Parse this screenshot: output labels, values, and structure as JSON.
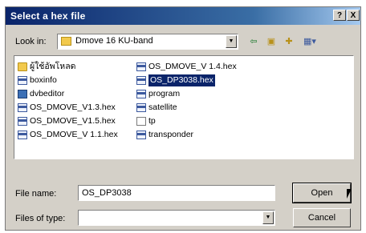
{
  "window": {
    "title": "Select a hex file",
    "help_label": "?",
    "close_label": "X"
  },
  "lookin": {
    "label": "Look in:",
    "value": "Dmove 16 KU-band"
  },
  "toolbar": {
    "back_icon": "back-arrow-icon",
    "up_icon": "up-folder-icon",
    "newfolder_icon": "new-folder-icon",
    "views_icon": "views-menu-icon"
  },
  "files": {
    "left": [
      {
        "name": "ผู้ใช้อัพโหลด",
        "icon": "folder-icon"
      },
      {
        "name": "boxinfo",
        "icon": "file-icon"
      },
      {
        "name": "dvbeditor",
        "icon": "app-icon"
      },
      {
        "name": "OS_DMOVE_V1.3.hex",
        "icon": "file-icon"
      },
      {
        "name": "OS_DMOVE_V1.5.hex",
        "icon": "file-icon"
      },
      {
        "name": "OS_DMOVE_V 1.1.hex",
        "icon": "file-icon"
      }
    ],
    "right": [
      {
        "name": "OS_DMOVE_V 1.4.hex",
        "icon": "file-icon"
      },
      {
        "name": "OS_DP3038.hex",
        "icon": "file-icon",
        "selected": true
      },
      {
        "name": "program",
        "icon": "file-icon"
      },
      {
        "name": "satellite",
        "icon": "file-icon"
      },
      {
        "name": "tp",
        "icon": "blank-file-icon"
      },
      {
        "name": "transponder",
        "icon": "file-icon"
      }
    ]
  },
  "filename": {
    "label": "File name:",
    "value": "OS_DP3038"
  },
  "filetype": {
    "label": "Files of type:",
    "value": ""
  },
  "buttons": {
    "open": "Open",
    "cancel": "Cancel"
  }
}
